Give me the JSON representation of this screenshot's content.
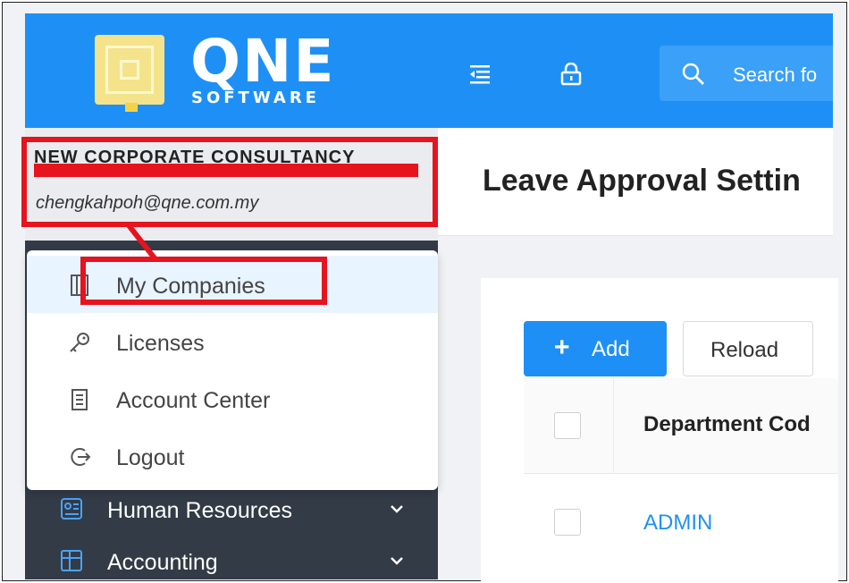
{
  "header": {
    "logo_text": "QNE",
    "logo_sub": "SOFTWARE",
    "search_placeholder": "Search fo",
    "colors": {
      "primary": "#1e90f5",
      "sidebar_dark": "#333b47",
      "annotation": "#e5141f"
    }
  },
  "user": {
    "company_name": "NEW CORPORATE CONSULTANCY",
    "email": "chengkahpoh@qne.com.my"
  },
  "user_menu": {
    "items": [
      {
        "label": "My Companies",
        "icon": "building-icon"
      },
      {
        "label": "Licenses",
        "icon": "key-icon"
      },
      {
        "label": "Account Center",
        "icon": "document-icon"
      },
      {
        "label": "Logout",
        "icon": "logout-icon"
      }
    ]
  },
  "sidebar": {
    "items": [
      {
        "label": "Human Resources",
        "icon": "hr-icon"
      },
      {
        "label": "Accounting",
        "icon": "accounting-icon"
      }
    ]
  },
  "main": {
    "page_title": "Leave Approval Settin",
    "add_label": "Add",
    "reload_label": "Reload",
    "table": {
      "columns": [
        "Department Cod"
      ],
      "rows": [
        {
          "department_code": "ADMIN"
        }
      ]
    }
  }
}
